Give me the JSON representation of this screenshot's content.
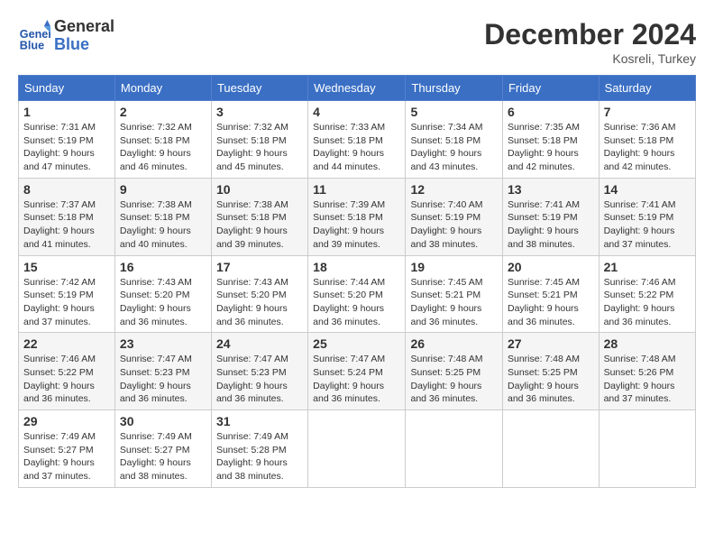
{
  "header": {
    "logo_line1": "General",
    "logo_line2": "Blue",
    "month_title": "December 2024",
    "subtitle": "Kosreli, Turkey"
  },
  "days_of_week": [
    "Sunday",
    "Monday",
    "Tuesday",
    "Wednesday",
    "Thursday",
    "Friday",
    "Saturday"
  ],
  "weeks": [
    [
      {
        "day": 1,
        "sunrise": "7:31 AM",
        "sunset": "5:19 PM",
        "daylight": "9 hours and 47 minutes."
      },
      {
        "day": 2,
        "sunrise": "7:32 AM",
        "sunset": "5:18 PM",
        "daylight": "9 hours and 46 minutes."
      },
      {
        "day": 3,
        "sunrise": "7:32 AM",
        "sunset": "5:18 PM",
        "daylight": "9 hours and 45 minutes."
      },
      {
        "day": 4,
        "sunrise": "7:33 AM",
        "sunset": "5:18 PM",
        "daylight": "9 hours and 44 minutes."
      },
      {
        "day": 5,
        "sunrise": "7:34 AM",
        "sunset": "5:18 PM",
        "daylight": "9 hours and 43 minutes."
      },
      {
        "day": 6,
        "sunrise": "7:35 AM",
        "sunset": "5:18 PM",
        "daylight": "9 hours and 42 minutes."
      },
      {
        "day": 7,
        "sunrise": "7:36 AM",
        "sunset": "5:18 PM",
        "daylight": "9 hours and 42 minutes."
      }
    ],
    [
      {
        "day": 8,
        "sunrise": "7:37 AM",
        "sunset": "5:18 PM",
        "daylight": "9 hours and 41 minutes."
      },
      {
        "day": 9,
        "sunrise": "7:38 AM",
        "sunset": "5:18 PM",
        "daylight": "9 hours and 40 minutes."
      },
      {
        "day": 10,
        "sunrise": "7:38 AM",
        "sunset": "5:18 PM",
        "daylight": "9 hours and 39 minutes."
      },
      {
        "day": 11,
        "sunrise": "7:39 AM",
        "sunset": "5:18 PM",
        "daylight": "9 hours and 39 minutes."
      },
      {
        "day": 12,
        "sunrise": "7:40 AM",
        "sunset": "5:19 PM",
        "daylight": "9 hours and 38 minutes."
      },
      {
        "day": 13,
        "sunrise": "7:41 AM",
        "sunset": "5:19 PM",
        "daylight": "9 hours and 38 minutes."
      },
      {
        "day": 14,
        "sunrise": "7:41 AM",
        "sunset": "5:19 PM",
        "daylight": "9 hours and 37 minutes."
      }
    ],
    [
      {
        "day": 15,
        "sunrise": "7:42 AM",
        "sunset": "5:19 PM",
        "daylight": "9 hours and 37 minutes."
      },
      {
        "day": 16,
        "sunrise": "7:43 AM",
        "sunset": "5:20 PM",
        "daylight": "9 hours and 36 minutes."
      },
      {
        "day": 17,
        "sunrise": "7:43 AM",
        "sunset": "5:20 PM",
        "daylight": "9 hours and 36 minutes."
      },
      {
        "day": 18,
        "sunrise": "7:44 AM",
        "sunset": "5:20 PM",
        "daylight": "9 hours and 36 minutes."
      },
      {
        "day": 19,
        "sunrise": "7:45 AM",
        "sunset": "5:21 PM",
        "daylight": "9 hours and 36 minutes."
      },
      {
        "day": 20,
        "sunrise": "7:45 AM",
        "sunset": "5:21 PM",
        "daylight": "9 hours and 36 minutes."
      },
      {
        "day": 21,
        "sunrise": "7:46 AM",
        "sunset": "5:22 PM",
        "daylight": "9 hours and 36 minutes."
      }
    ],
    [
      {
        "day": 22,
        "sunrise": "7:46 AM",
        "sunset": "5:22 PM",
        "daylight": "9 hours and 36 minutes."
      },
      {
        "day": 23,
        "sunrise": "7:47 AM",
        "sunset": "5:23 PM",
        "daylight": "9 hours and 36 minutes."
      },
      {
        "day": 24,
        "sunrise": "7:47 AM",
        "sunset": "5:23 PM",
        "daylight": "9 hours and 36 minutes."
      },
      {
        "day": 25,
        "sunrise": "7:47 AM",
        "sunset": "5:24 PM",
        "daylight": "9 hours and 36 minutes."
      },
      {
        "day": 26,
        "sunrise": "7:48 AM",
        "sunset": "5:25 PM",
        "daylight": "9 hours and 36 minutes."
      },
      {
        "day": 27,
        "sunrise": "7:48 AM",
        "sunset": "5:25 PM",
        "daylight": "9 hours and 36 minutes."
      },
      {
        "day": 28,
        "sunrise": "7:48 AM",
        "sunset": "5:26 PM",
        "daylight": "9 hours and 37 minutes."
      }
    ],
    [
      {
        "day": 29,
        "sunrise": "7:49 AM",
        "sunset": "5:27 PM",
        "daylight": "9 hours and 37 minutes."
      },
      {
        "day": 30,
        "sunrise": "7:49 AM",
        "sunset": "5:27 PM",
        "daylight": "9 hours and 38 minutes."
      },
      {
        "day": 31,
        "sunrise": "7:49 AM",
        "sunset": "5:28 PM",
        "daylight": "9 hours and 38 minutes."
      },
      null,
      null,
      null,
      null
    ]
  ]
}
